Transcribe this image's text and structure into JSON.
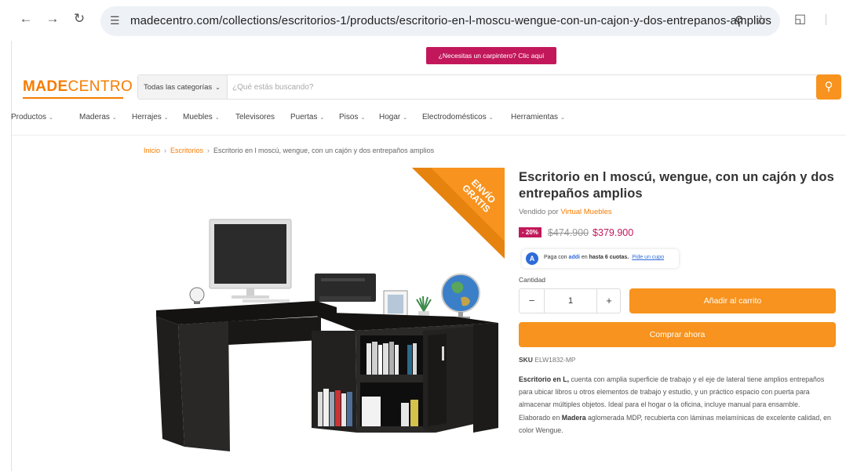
{
  "browser": {
    "back_icon": "arrow-left",
    "forward_icon": "arrow-right",
    "reload_icon": "reload",
    "url": "madecentro.com/collections/escritorios-1/products/escritorio-en-l-moscu-wengue-con-un-cajon-y-dos-entrepanos-amplios"
  },
  "promo": {
    "label": "¿Necesitas un carpintero? Clic aquí"
  },
  "header": {
    "logo_bold": "MADE",
    "logo_rest": "CENTRO",
    "category_select": "Todas las categorías",
    "search_placeholder": "¿Qué estás buscando?"
  },
  "nav": {
    "items": [
      {
        "label": "Productos"
      },
      {
        "label": "Maderas"
      },
      {
        "label": "Herrajes"
      },
      {
        "label": "Muebles"
      },
      {
        "label": "Televisores"
      },
      {
        "label": "Puertas"
      },
      {
        "label": "Pisos"
      },
      {
        "label": "Hogar"
      },
      {
        "label": "Electrodomésticos"
      },
      {
        "label": "Herramientas"
      }
    ]
  },
  "breadcrumb": {
    "items": [
      "Inicio",
      "Escritorios",
      "Escritorio en l moscú, wengue, con un cajón y dos entrepaños amplios"
    ]
  },
  "ribbon": {
    "line1": "ENVÍO",
    "line2": "GRATIS"
  },
  "product": {
    "title": "Escritorio en l moscú, wengue, con un cajón y dos entrepaños amplios",
    "vendor_prefix": "Vendido por",
    "vendor": "Virtual Muebles",
    "discount": "- 20%",
    "old_price": "$474.900",
    "new_price": "$379.900",
    "sku_label": "SKU",
    "sku": "ELW1832-MP"
  },
  "addi": {
    "prefix": "Paga con",
    "brand": "addi",
    "middle": "en",
    "installments": "hasta 6 cuotas.",
    "link": "Pide un cupo"
  },
  "quantity": {
    "label": "Cantidad",
    "value": "1",
    "minus": "−",
    "plus": "+"
  },
  "actions": {
    "add_to_cart": "Añadir al carrito",
    "buy_now": "Comprar ahora"
  },
  "description": {
    "p1_bold": "Escritorio en L,",
    "p1_rest": " cuenta con amplia superficie de trabajo y el eje de lateral tiene amplios entrepaños para ubicar libros u otros elementos de trabajo y estudio, y un práctico espacio con puerta para almacenar múltiples objetos. Ideal para el hogar o la oficina, incluye manual para ensamble.",
    "p2_prefix": "Elaborado en ",
    "p2_bold": "Madera",
    "p2_rest": " aglomerada MDP, recubierta con láminas melamínicas de excelente calidad, en color Wengue."
  },
  "colors": {
    "brand_orange": "#f7931e",
    "promo_pink": "#c2185b",
    "desk_wengue": "#1c1a19"
  }
}
